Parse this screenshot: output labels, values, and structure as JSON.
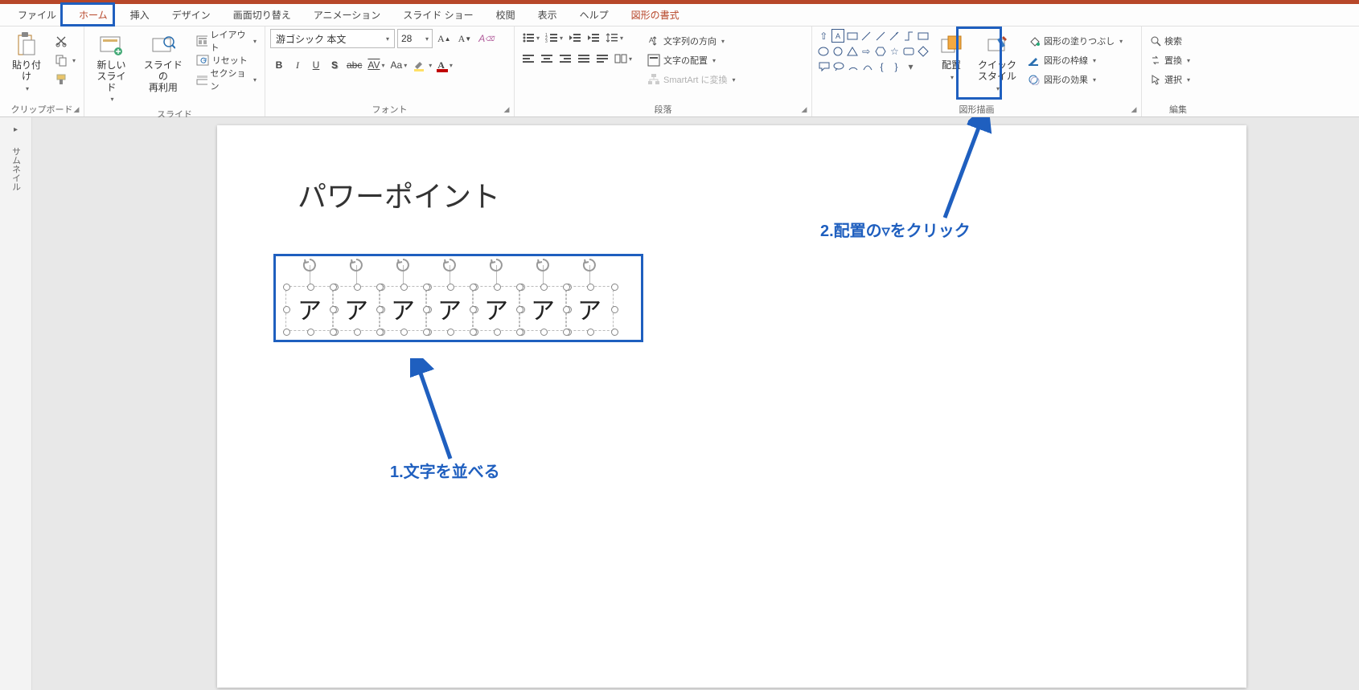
{
  "tabs": {
    "file": "ファイル",
    "home": "ホーム",
    "insert": "挿入",
    "design": "デザイン",
    "transition": "画面切り替え",
    "animation": "アニメーション",
    "slideshow": "スライド ショー",
    "review": "校閲",
    "view": "表示",
    "help": "ヘルプ",
    "shapeformat": "図形の書式"
  },
  "groups": {
    "clipboard": "クリップボード",
    "slides": "スライド",
    "font": "フォント",
    "paragraph": "段落",
    "drawing": "図形描画",
    "editing": "編集"
  },
  "clipboard": {
    "paste": "貼り付け"
  },
  "slides": {
    "newSlide": "新しい\nスライド",
    "reuse": "スライドの\n再利用",
    "layout": "レイアウト",
    "reset": "リセット",
    "section": "セクション"
  },
  "font": {
    "name": "游ゴシック 本文",
    "size": "28",
    "bold": "B",
    "italic": "I",
    "underline": "U",
    "strike": "S",
    "shadow": "abc",
    "spacing": "AV",
    "case": "Aa"
  },
  "paragraph": {
    "textDirection": "文字列の方向",
    "alignText": "文字の配置",
    "smartart": "SmartArt に変換"
  },
  "drawing": {
    "arrange": "配置",
    "quickStyles": "クイック\nスタイル",
    "fill": "図形の塗りつぶし",
    "outline": "図形の枠線",
    "effects": "図形の効果"
  },
  "editing": {
    "find": "検索",
    "replace": "置換",
    "select": "選択"
  },
  "thumb": {
    "label": "サムネイル"
  },
  "slide": {
    "title": "パワーポイント",
    "char": "ア"
  },
  "annotations": {
    "step1": "1.文字を並べる",
    "step2": "2.配置の▿をクリック"
  }
}
